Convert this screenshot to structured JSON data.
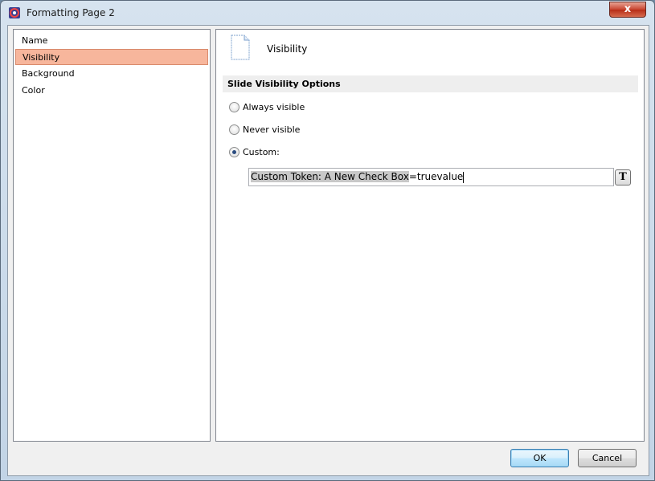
{
  "window": {
    "title": "Formatting Page 2",
    "close_label": "x"
  },
  "nav": {
    "items": [
      {
        "label": "Name"
      },
      {
        "label": "Visibility",
        "selected": true
      },
      {
        "label": "Background"
      },
      {
        "label": "Color"
      }
    ]
  },
  "panel": {
    "title": "Visibility",
    "section_header": "Slide Visibility Options",
    "options": [
      {
        "label": "Always visible",
        "checked": false
      },
      {
        "label": "Never visible",
        "checked": false
      },
      {
        "label": "Custom:",
        "checked": true
      }
    ],
    "custom_value_selected": "Custom Token: A New Check Box",
    "custom_value_rest": "=truevalue",
    "token_button_label": "T"
  },
  "buttons": {
    "ok": "OK",
    "cancel": "Cancel"
  },
  "colors": {
    "selection": "#f7b69c",
    "close": "#c7432e"
  }
}
